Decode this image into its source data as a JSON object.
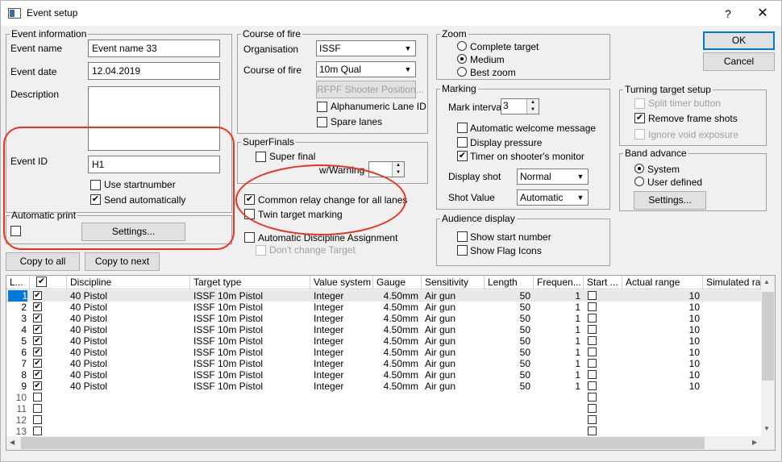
{
  "window": {
    "title": "Event setup",
    "help_glyph": "?",
    "close_glyph": "✕"
  },
  "event_info": {
    "legend": "Event information",
    "name_label": "Event name",
    "name_value": "Event name 33",
    "date_label": "Event date",
    "date_value": "12.04.2019",
    "desc_label": "Description",
    "desc_value": "",
    "id_label": "Event ID",
    "id_value": "H1",
    "use_startnumber": "Use startnumber",
    "send_auto": "Send automatically"
  },
  "auto_print": {
    "legend": "Automatic print",
    "settings": "Settings..."
  },
  "buttons": {
    "copy_all": "Copy to all",
    "copy_next": "Copy to next",
    "ok": "OK",
    "cancel": "Cancel"
  },
  "course": {
    "legend": "Course of fire",
    "org_label": "Organisation",
    "org_value": "ISSF",
    "cof_label": "Course of fire",
    "cof_value": "10m Qual",
    "rfpf": "RFPF Shooter Position...",
    "alpha": "Alphanumeric Lane ID",
    "spare": "Spare lanes"
  },
  "superfinals": {
    "legend": "SuperFinals",
    "super_final": "Super final",
    "warning_label": "w/Warning",
    "warning_value": ""
  },
  "relay": {
    "common": "Common relay change for all lanes",
    "twin": "Twin target marking",
    "auto_disc": "Automatic Discipline Assignment",
    "dont_change": "Don't change Target"
  },
  "zoom": {
    "legend": "Zoom",
    "complete": "Complete target",
    "medium": "Medium",
    "best": "Best zoom"
  },
  "marking": {
    "legend": "Marking",
    "interval_label": "Mark interval",
    "interval_value": "3",
    "welcome": "Automatic welcome message",
    "pressure": "Display pressure",
    "timer": "Timer on shooter's monitor",
    "display_shot_label": "Display shot",
    "display_shot_value": "Normal",
    "shot_value_label": "Shot Value",
    "shot_value_value": "Automatic"
  },
  "audience": {
    "legend": "Audience display",
    "start_number": "Show start number",
    "flag_icons": "Show Flag Icons"
  },
  "turning": {
    "legend": "Turning target setup",
    "split": "Split timer button",
    "remove": "Remove frame shots",
    "ignore": "Ignore void exposure"
  },
  "band": {
    "legend": "Band advance",
    "system": "System",
    "user_defined": "User defined",
    "settings": "Settings..."
  },
  "grid": {
    "headers": [
      "L...",
      "",
      "Discipline",
      "Target type",
      "Value system",
      "Gauge",
      "Sensitivity",
      "Length",
      "Frequen...",
      "Start ...",
      "Actual range",
      "Simulated ran"
    ],
    "rows": [
      {
        "lane": "1",
        "discipline": "40 Pistol",
        "target": "ISSF 10m Pistol",
        "value": "Integer",
        "gauge": "4.50mm",
        "sens": "Air gun",
        "length": "50",
        "freq": "1",
        "actual": "10"
      },
      {
        "lane": "2",
        "discipline": "40 Pistol",
        "target": "ISSF 10m Pistol",
        "value": "Integer",
        "gauge": "4.50mm",
        "sens": "Air gun",
        "length": "50",
        "freq": "1",
        "actual": "10"
      },
      {
        "lane": "3",
        "discipline": "40 Pistol",
        "target": "ISSF 10m Pistol",
        "value": "Integer",
        "gauge": "4.50mm",
        "sens": "Air gun",
        "length": "50",
        "freq": "1",
        "actual": "10"
      },
      {
        "lane": "4",
        "discipline": "40 Pistol",
        "target": "ISSF 10m Pistol",
        "value": "Integer",
        "gauge": "4.50mm",
        "sens": "Air gun",
        "length": "50",
        "freq": "1",
        "actual": "10"
      },
      {
        "lane": "5",
        "discipline": "40 Pistol",
        "target": "ISSF 10m Pistol",
        "value": "Integer",
        "gauge": "4.50mm",
        "sens": "Air gun",
        "length": "50",
        "freq": "1",
        "actual": "10"
      },
      {
        "lane": "6",
        "discipline": "40 Pistol",
        "target": "ISSF 10m Pistol",
        "value": "Integer",
        "gauge": "4.50mm",
        "sens": "Air gun",
        "length": "50",
        "freq": "1",
        "actual": "10"
      },
      {
        "lane": "7",
        "discipline": "40 Pistol",
        "target": "ISSF 10m Pistol",
        "value": "Integer",
        "gauge": "4.50mm",
        "sens": "Air gun",
        "length": "50",
        "freq": "1",
        "actual": "10"
      },
      {
        "lane": "8",
        "discipline": "40 Pistol",
        "target": "ISSF 10m Pistol",
        "value": "Integer",
        "gauge": "4.50mm",
        "sens": "Air gun",
        "length": "50",
        "freq": "1",
        "actual": "10"
      },
      {
        "lane": "9",
        "discipline": "40 Pistol",
        "target": "ISSF 10m Pistol",
        "value": "Integer",
        "gauge": "4.50mm",
        "sens": "Air gun",
        "length": "50",
        "freq": "1",
        "actual": "10"
      },
      {
        "lane": "10",
        "discipline": "",
        "target": "",
        "value": "",
        "gauge": "",
        "sens": "",
        "length": "",
        "freq": "",
        "actual": ""
      },
      {
        "lane": "11",
        "discipline": "",
        "target": "",
        "value": "",
        "gauge": "",
        "sens": "",
        "length": "",
        "freq": "",
        "actual": ""
      },
      {
        "lane": "12",
        "discipline": "",
        "target": "",
        "value": "",
        "gauge": "",
        "sens": "",
        "length": "",
        "freq": "",
        "actual": ""
      },
      {
        "lane": "13",
        "discipline": "",
        "target": "",
        "value": "",
        "gauge": "",
        "sens": "",
        "length": "",
        "freq": "",
        "actual": ""
      }
    ]
  },
  "glyphs": {
    "check": "✔",
    "arrow_down": "▼",
    "arrow_up": "▲",
    "arrow_left": "◀",
    "arrow_right": "▶"
  },
  "colors": {
    "highlight": "#e8331f",
    "selection": "#0078d7"
  }
}
